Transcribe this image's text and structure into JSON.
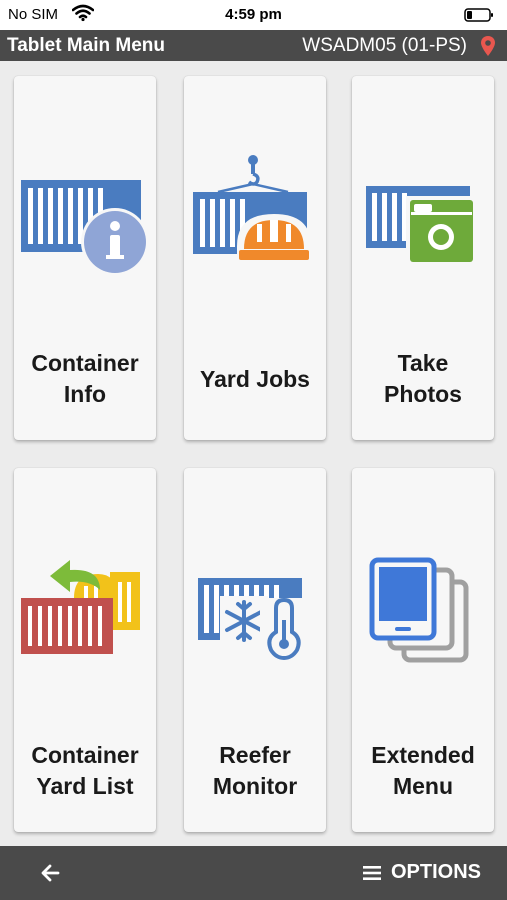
{
  "status_bar": {
    "carrier": "No SIM",
    "time": "4:59 pm"
  },
  "header": {
    "title": "Tablet Main Menu",
    "device": "WSADM05 (01-PS)"
  },
  "tiles": [
    {
      "label_line1": "Container",
      "label_line2": "Info",
      "icon": "container-info-icon"
    },
    {
      "label_line1": "Yard Jobs",
      "label_line2": "",
      "icon": "yard-jobs-icon"
    },
    {
      "label_line1": "Take",
      "label_line2": "Photos",
      "icon": "take-photos-icon"
    },
    {
      "label_line1": "Container",
      "label_line2": "Yard List",
      "icon": "container-yard-list-icon"
    },
    {
      "label_line1": "Reefer",
      "label_line2": "Monitor",
      "icon": "reefer-monitor-icon"
    },
    {
      "label_line1": "Extended",
      "label_line2": "Menu",
      "icon": "extended-menu-icon"
    }
  ],
  "footer": {
    "options_label": "OPTIONS",
    "back_icon": "back-arrow-icon",
    "menu_icon": "hamburger-icon"
  },
  "colors": {
    "container_blue": "#4a7cc0",
    "info_circle": "#8fa5d6",
    "hard_hat": "#f0892b",
    "camera_green": "#6eaa3a",
    "yard_red": "#c0504d",
    "yard_yellow": "#f2c21a",
    "arrow_green": "#7dbb3a",
    "tablet_blue": "#3f78d8",
    "bar_dark": "#4a4a4a",
    "pin_red": "#e8574f"
  }
}
